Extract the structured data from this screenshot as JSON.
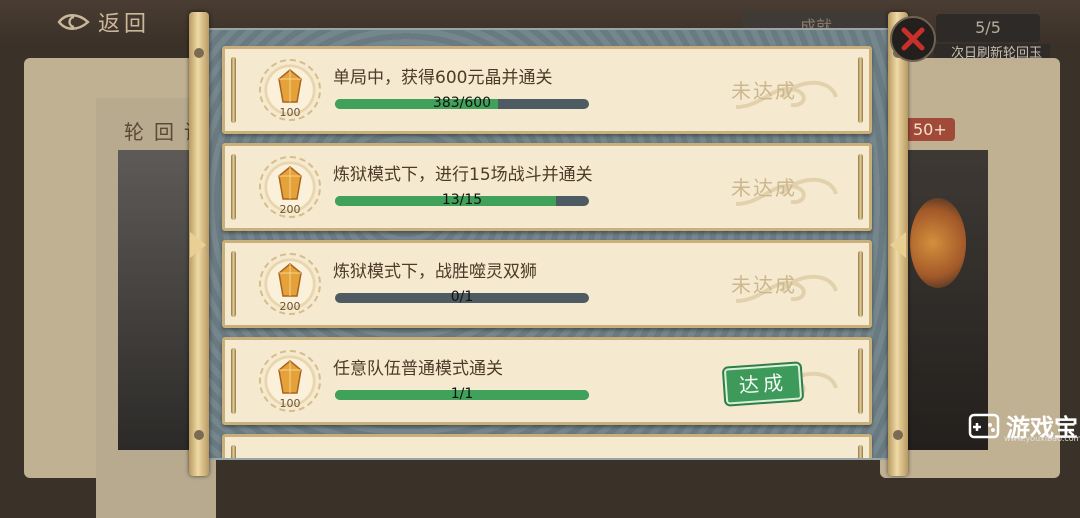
{
  "header": {
    "back_label": "返回",
    "tab_label": "成就",
    "counter": "5/5",
    "refresh_tip": "次日刷新轮回玉"
  },
  "background": {
    "left_title": "轮回诀",
    "right_badge": "50+"
  },
  "tasks": [
    {
      "description": "单局中，获得600元晶并通关",
      "progress_text": "383/600",
      "progress": 0.64,
      "reward_amount": "100",
      "status": "未达成",
      "completed": false
    },
    {
      "description": "炼狱模式下，进行15场战斗并通关",
      "progress_text": "13/15",
      "progress": 0.87,
      "reward_amount": "200",
      "status": "未达成",
      "completed": false
    },
    {
      "description": "炼狱模式下，战胜噬灵双狮",
      "progress_text": "0/1",
      "progress": 0.0,
      "reward_amount": "200",
      "status": "未达成",
      "completed": false
    },
    {
      "description": "任意队伍普通模式通关",
      "progress_text": "1/1",
      "progress": 1.0,
      "reward_amount": "100",
      "status": "达成",
      "completed": true
    }
  ],
  "watermark": {
    "brand": "游戏宝",
    "url": "www.youxibao.com"
  },
  "colors": {
    "card_bg": "#f5ead0",
    "progress_fill": "#3fa15a",
    "progress_track": "#4e5b62",
    "stamp_green": "#3d9a5a",
    "scroll_bg": "#6e7f86"
  },
  "icons": [
    "back-arrow-icon",
    "close-icon",
    "crystal-icon",
    "left-arrow-icon",
    "right-arrow-icon",
    "gamepad-icon"
  ]
}
